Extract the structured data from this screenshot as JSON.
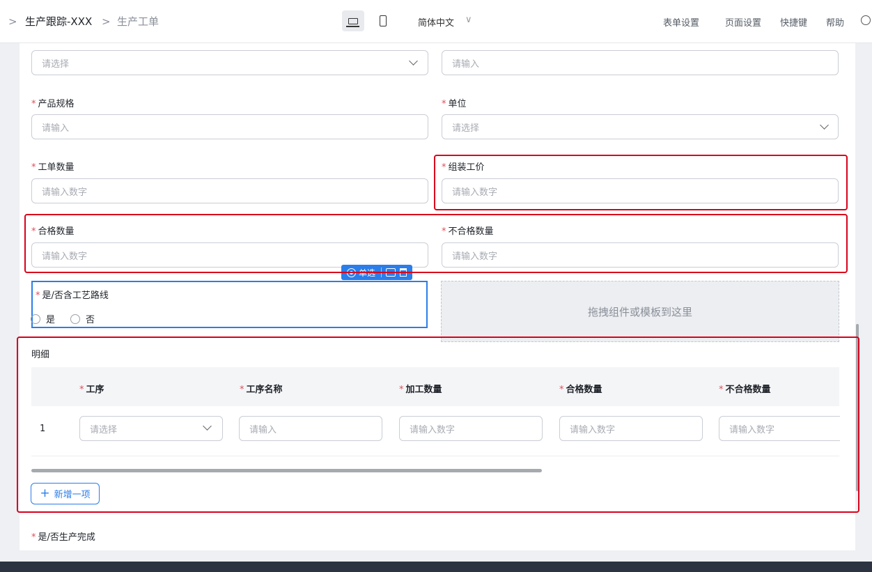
{
  "breadcrumb": {
    "app": "生产跟踪-XXX",
    "page": "生产工单"
  },
  "topbar": {
    "language": "简体中文",
    "menu": [
      "表单设置",
      "页面设置",
      "快捷键",
      "帮助"
    ]
  },
  "form": {
    "top_left_placeholder": "请选择",
    "top_right_placeholder": "请输入",
    "fields": [
      {
        "label": "产品规格",
        "placeholder": "请输入"
      },
      {
        "label": "单位",
        "placeholder": "请选择"
      },
      {
        "label": "工单数量",
        "placeholder": "请输入数字"
      },
      {
        "label": "组装工价",
        "placeholder": "请输入数字"
      },
      {
        "label": "合格数量",
        "placeholder": "请输入数字"
      },
      {
        "label": "不合格数量",
        "placeholder": "请输入数字"
      }
    ],
    "radio_field": {
      "label": "是/否含工艺路线",
      "options": [
        "是",
        "否"
      ]
    },
    "toolbar_label": "单选",
    "dropzone_text": "拖拽组件或模板到这里",
    "detail": {
      "title": "明细",
      "columns": [
        "工序",
        "工序名称",
        "加工数量",
        "合格数量",
        "不合格数量"
      ],
      "row_index": "1",
      "row_placeholders": [
        "请选择",
        "请输入",
        "请输入数字",
        "请输入数字",
        "请输入数字"
      ],
      "add_label": "新增一项"
    },
    "last_field_label": "是/否生产完成"
  },
  "colors": {
    "accent": "#2b7de9",
    "required": "#e34d59",
    "highlight": "#d9001b"
  }
}
